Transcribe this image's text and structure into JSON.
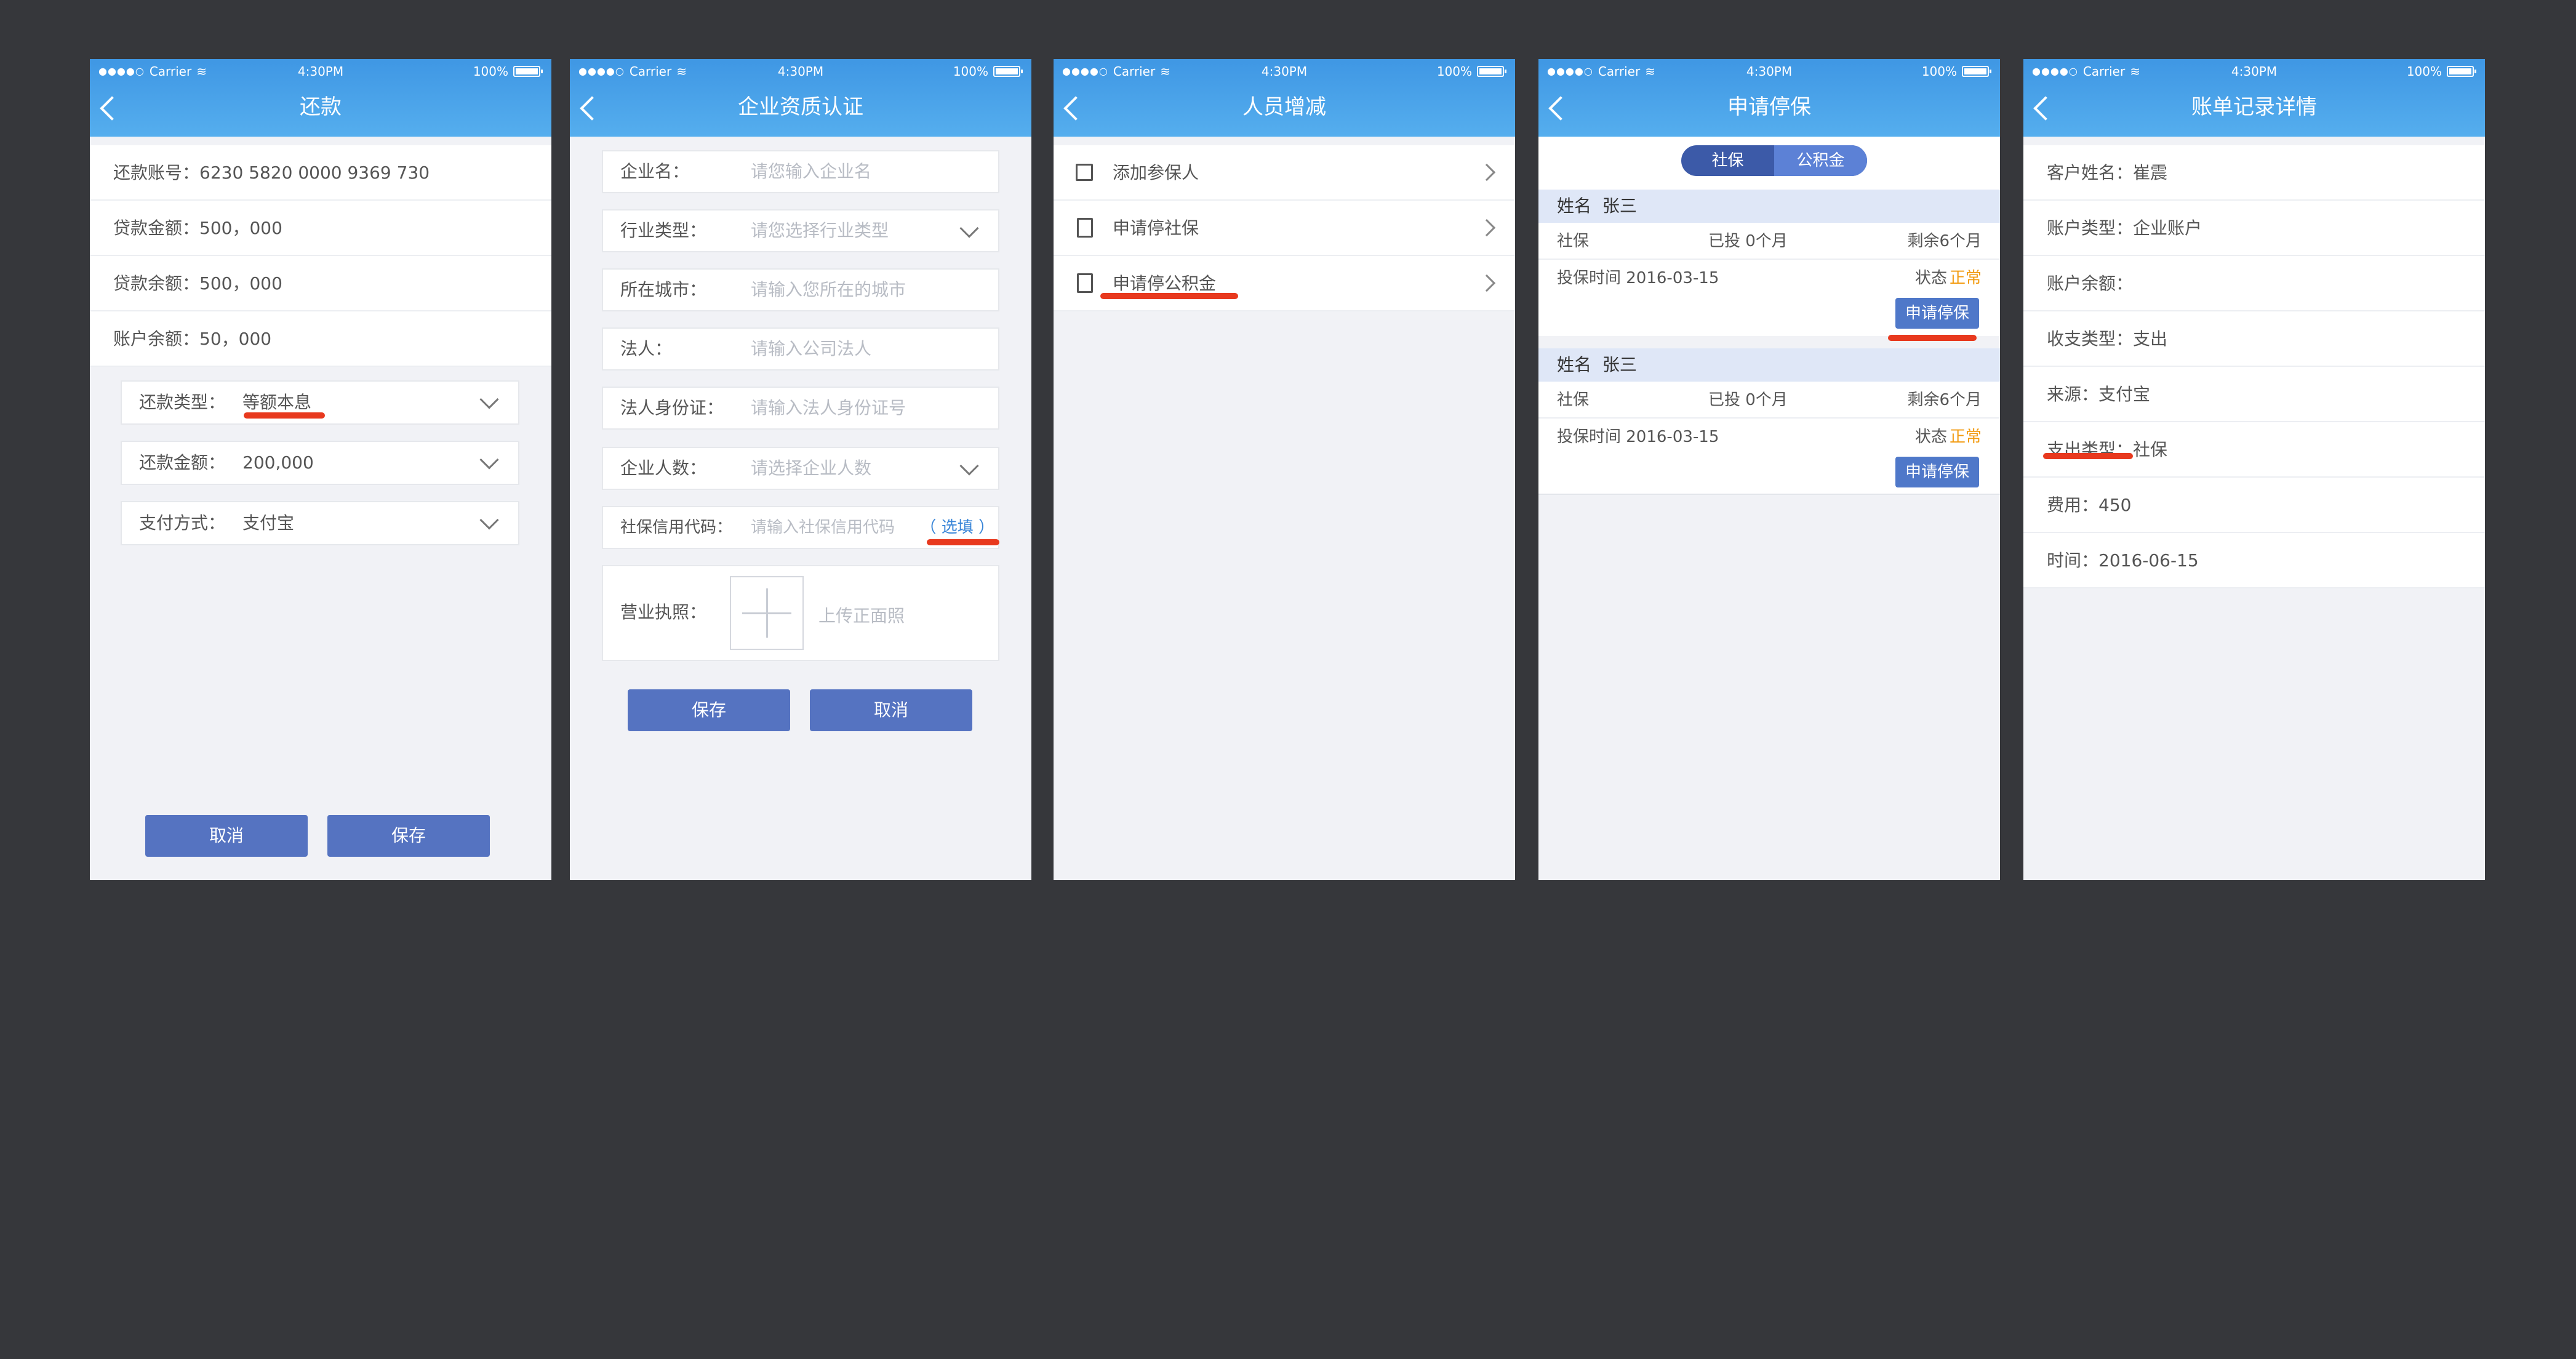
{
  "status": {
    "dots": "●●●●○",
    "carrier": "Carrier",
    "time": "4:30PM",
    "battery": "100%"
  },
  "screens": [
    {
      "title": "还款",
      "rows": [
        "还款账号：6230 5820 0000 9369 730",
        "贷款金额：500，000",
        "贷款余额：500，000",
        "账户余额：50，000"
      ],
      "form": [
        {
          "label": "还款类型：",
          "value": "等额本息"
        },
        {
          "label": "还款金额：",
          "value": "200,000"
        },
        {
          "label": "支付方式：",
          "value": "支付宝"
        }
      ],
      "cancel": "取消",
      "save": "保存"
    },
    {
      "title": "企业资质认证",
      "fields": [
        {
          "label": "企业名：",
          "placeholder": "请您输入企业名"
        },
        {
          "label": "行业类型：",
          "placeholder": "请您选择行业类型"
        },
        {
          "label": "所在城市：",
          "placeholder": "请输入您所在的城市"
        },
        {
          "label": "法人：",
          "placeholder": "请输入公司法人"
        },
        {
          "label": "法人身份证：",
          "placeholder": "请输入法人身份证号"
        },
        {
          "label": "企业人数：",
          "placeholder": "请选择企业人数"
        },
        {
          "label": "社保信用代码：",
          "placeholder": "请输入社保信用代码",
          "optional": "（ 选填 ）"
        }
      ],
      "license_label": "营业执照：",
      "upload_text": "上传正面照",
      "save": "保存",
      "cancel": "取消"
    },
    {
      "title": "人员增减",
      "items": [
        "添加参保人",
        "申请停社保",
        "申请停公积金"
      ]
    },
    {
      "title": "申请停保",
      "tabs": [
        "社保",
        "公积金"
      ],
      "cards": [
        {
          "name_label": "姓名",
          "name": "张三",
          "type": "社保",
          "paid": "已投  0个月",
          "remain": "剩余6个月",
          "time": "投保时间  2016-03-15",
          "status_label": "状态",
          "status": "正常",
          "button": "申请停保"
        },
        {
          "name_label": "姓名",
          "name": "张三",
          "type": "社保",
          "paid": "已投  0个月",
          "remain": "剩余6个月",
          "time": "投保时间  2016-03-15",
          "status_label": "状态",
          "status": "正常",
          "button": "申请停保"
        }
      ]
    },
    {
      "title": "账单记录详情",
      "rows": [
        "客户姓名：崔震",
        "账户类型：企业账户",
        "账户余额：",
        "收支类型：支出",
        "来源：支付宝",
        "支出类型：社保",
        "费用：450",
        "时间：2016-06-15"
      ]
    }
  ]
}
